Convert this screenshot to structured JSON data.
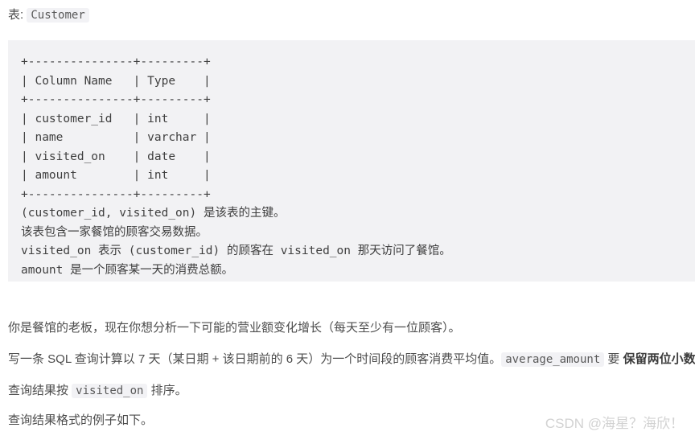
{
  "intro": {
    "label": "表: ",
    "table_name": "Customer"
  },
  "code_block": {
    "language": "text",
    "background": "#f2f2f4",
    "lines": [
      "+---------------+---------+",
      "| Column Name   | Type    |",
      "+---------------+---------+",
      "| customer_id   | int     |",
      "| name          | varchar |",
      "| visited_on    | date    |",
      "| amount        | int     |",
      "+---------------+---------+",
      "(customer_id, visited_on) 是该表的主键。",
      "该表包含一家餐馆的顾客交易数据。",
      "visited_on 表示 (customer_id) 的顾客在 visited_on 那天访问了餐馆。",
      "amount 是一个顾客某一天的消费总额。"
    ],
    "text": "+---------------+---------+\n| Column Name   | Type    |\n+---------------+---------+\n| customer_id   | int     |\n| name          | varchar |\n| visited_on    | date    |\n| amount        | int     |\n+---------------+---------+\n(customer_id, visited_on) 是该表的主键。\n该表包含一家餐馆的顾客交易数据。\nvisited_on 表示 (customer_id) 的顾客在 visited_on 那天访问了餐馆。\namount 是一个顾客某一天的消费总额。"
  },
  "paragraphs": {
    "p1": "你是餐馆的老板，现在你想分析一下可能的营业额变化增长（每天至少有一位顾客）。",
    "p2_before": "写一条 SQL 查询计算以 7 天（某日期 + 该日期前的 6 天）为一个时间段的顾客消费平均值。",
    "p2_code": "average_amount",
    "p2_mid": " 要 ",
    "p2_bold": "保留两位小数",
    "p2_after": "。",
    "p3_before": "查询结果按 ",
    "p3_code": "visited_on",
    "p3_after": " 排序。",
    "p4": "查询结果格式的例子如下。"
  },
  "watermark": {
    "text": "CSDN @海星？海欣！",
    "color": "#d2d2d2"
  }
}
